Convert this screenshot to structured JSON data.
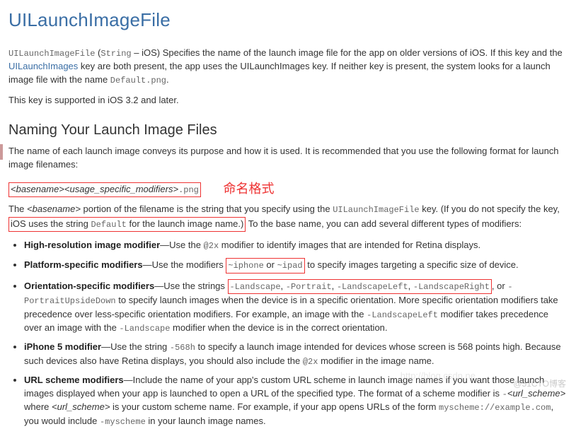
{
  "title": "UILaunchImageFile",
  "intro": {
    "code1": "UILaunchImageFile",
    "paren": "(",
    "type": "String",
    "dash": " – iOS) ",
    "text1": "Specifies the name of the launch image file for the app on older versions of iOS. If this key and the ",
    "link": "UILaunchImages",
    "text2": " key are both present, the app uses the UILaunchImages key. If neither key is present, the system looks for a launch image file with the name ",
    "code2": "Default.png",
    "text3": "."
  },
  "supported": "This key is supported in iOS 3.2 and later.",
  "section2": "Naming Your Launch Image Files",
  "naming_intro": "The name of each launch image conveys its purpose and how it is used. It is recommended that you use the following format for launch image filenames:",
  "format": {
    "basename": "<basename>",
    "mods": "<usage_specific_modifiers>",
    "ext": ".png"
  },
  "annotation": "命名格式",
  "para2": {
    "t1": "The ",
    "basename": "<basename>",
    "t2": " portion of the filename is the string that you specify using the ",
    "code": "UILaunchImageFile",
    "t3": " key. (If you do not specify the key, ",
    "boxed1": "iOS uses the string ",
    "boxedcode": "Default",
    "boxed2": " for the launch image name.)",
    "t4": " To the base name, you can add several different types of modifiers:"
  },
  "items": {
    "hr": {
      "label": "High-resolution image modifier",
      "t1": "—Use the ",
      "c": "@2x",
      "t2": " modifier to identify images that are intended for Retina displays."
    },
    "plat": {
      "label": "Platform-specific modifiers",
      "t1": "—Use the modifiers ",
      "c1": "~iphone",
      "or": " or ",
      "c2": "~ipad",
      "t2": " to specify images targeting a specific size of device."
    },
    "orient": {
      "label": "Orientation-specific modifiers",
      "t1": "—Use the strings ",
      "c1": "-Landscape",
      "s": ", ",
      "c2": "-Portrait",
      "c3": "-LandscapeLeft",
      "c4": "-LandscapeRight",
      "t1b": ", or ",
      "c5": "-PortraitUpsideDown",
      "t2": " to specify launch images when the device is in a specific orientation. More specific orientation modifiers take precedence over less-specific orientation modifiers. For example, an image with the ",
      "c6": "-LandscapeLeft",
      "t3": " modifier takes precedence over an image with the ",
      "c7": "-Landscape",
      "t4": " modifier when the device is in the correct orientation."
    },
    "i5": {
      "label": "iPhone 5 modifier",
      "t1": "—Use the string ",
      "c1": "-568h",
      "t2": " to specify a launch image intended for devices whose screen is 568 points high. Because such devices also have Retina displays, you should also include the ",
      "c2": "@2x",
      "t3": " modifier in the image name."
    },
    "url": {
      "label": "URL scheme modifiers",
      "t1": "—Include the name of your app's custom URL scheme in launch image names if you want those launch images displayed when your app is launched to open a URL of the specified type. The format of a scheme modifier is ",
      "c1": "-",
      "u1": "<url_scheme>",
      "t2": " where ",
      "u2": "<url_scheme>",
      "t3": " is your custom scheme name. For example, if your app opens URLs of the form ",
      "c2": "myscheme://example.com",
      "t4": ", you would include ",
      "c3": "-myscheme",
      "t5": " in your launch image names."
    }
  },
  "wm1": "@51CTO博客",
  "wm2": "http://blog.csdn.ne"
}
